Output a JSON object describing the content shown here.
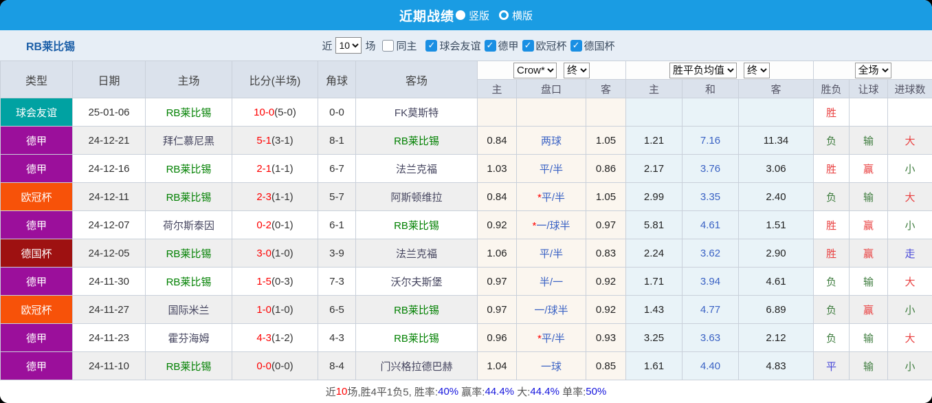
{
  "titlebar": {
    "title": "近期战绩",
    "vertical_label": "竖版",
    "horizontal_label": "横版"
  },
  "filter": {
    "team": "RB莱比锡",
    "prefix_label": "近",
    "count_value": "10",
    "suffix_label": "场",
    "same_home_label": "同主",
    "leagues": [
      "球会友谊",
      "德甲",
      "欧冠杯",
      "德国杯"
    ]
  },
  "icons": {
    "check": "✓"
  },
  "table": {
    "headers": [
      "类型",
      "日期",
      "主场",
      "比分(半场)",
      "角球",
      "客场"
    ],
    "selects": {
      "source": "Crow*",
      "source_period": "终",
      "wdl": "胜平负均值",
      "wdl_period": "终",
      "scope": "全场"
    },
    "subheaders": [
      "主",
      "盘口",
      "客",
      "主",
      "和",
      "客",
      "胜负",
      "让球",
      "进球数"
    ],
    "rows": [
      {
        "type": "球会友谊",
        "type_key": "friendly",
        "date": "25-01-06",
        "home": "RB莱比锡",
        "score": "10-0",
        "half": "(5-0)",
        "corner": "0-0",
        "away": "FK莫斯特",
        "o1": "",
        "handicap": "",
        "star": false,
        "o2": "",
        "w1": "",
        "w2": "",
        "w3": "",
        "res": "胜",
        "give": "",
        "goal": ""
      },
      {
        "type": "德甲",
        "type_key": "bundesliga",
        "date": "24-12-21",
        "home": "拜仁慕尼黑",
        "score": "5-1",
        "half": "(3-1)",
        "corner": "8-1",
        "away": "RB莱比锡",
        "o1": "0.84",
        "handicap": "两球",
        "star": false,
        "o2": "1.05",
        "w1": "1.21",
        "w2": "7.16",
        "w3": "11.34",
        "res": "负",
        "give": "输",
        "goal": "大"
      },
      {
        "type": "德甲",
        "type_key": "bundesliga",
        "date": "24-12-16",
        "home": "RB莱比锡",
        "score": "2-1",
        "half": "(1-1)",
        "corner": "6-7",
        "away": "法兰克福",
        "o1": "1.03",
        "handicap": "平/半",
        "star": false,
        "o2": "0.86",
        "w1": "2.17",
        "w2": "3.76",
        "w3": "3.06",
        "res": "胜",
        "give": "赢",
        "goal": "小"
      },
      {
        "type": "欧冠杯",
        "type_key": "ucl",
        "date": "24-12-11",
        "home": "RB莱比锡",
        "score": "2-3",
        "half": "(1-1)",
        "corner": "5-7",
        "away": "阿斯顿维拉",
        "o1": "0.84",
        "handicap": "平/半",
        "star": true,
        "o2": "1.05",
        "w1": "2.99",
        "w2": "3.35",
        "w3": "2.40",
        "res": "负",
        "give": "输",
        "goal": "大"
      },
      {
        "type": "德甲",
        "type_key": "bundesliga",
        "date": "24-12-07",
        "home": "荷尔斯泰因",
        "score": "0-2",
        "half": "(0-1)",
        "corner": "6-1",
        "away": "RB莱比锡",
        "o1": "0.92",
        "handicap": "一/球半",
        "star": true,
        "o2": "0.97",
        "w1": "5.81",
        "w2": "4.61",
        "w3": "1.51",
        "res": "胜",
        "give": "赢",
        "goal": "小"
      },
      {
        "type": "德国杯",
        "type_key": "dfb",
        "date": "24-12-05",
        "home": "RB莱比锡",
        "score": "3-0",
        "half": "(1-0)",
        "corner": "3-9",
        "away": "法兰克福",
        "o1": "1.06",
        "handicap": "平/半",
        "star": false,
        "o2": "0.83",
        "w1": "2.24",
        "w2": "3.62",
        "w3": "2.90",
        "res": "胜",
        "give": "赢",
        "goal": "走"
      },
      {
        "type": "德甲",
        "type_key": "bundesliga",
        "date": "24-11-30",
        "home": "RB莱比锡",
        "score": "1-5",
        "half": "(0-3)",
        "corner": "7-3",
        "away": "沃尔夫斯堡",
        "o1": "0.97",
        "handicap": "半/一",
        "star": false,
        "o2": "0.92",
        "w1": "1.71",
        "w2": "3.94",
        "w3": "4.61",
        "res": "负",
        "give": "输",
        "goal": "大"
      },
      {
        "type": "欧冠杯",
        "type_key": "ucl",
        "date": "24-11-27",
        "home": "国际米兰",
        "score": "1-0",
        "half": "(1-0)",
        "corner": "6-5",
        "away": "RB莱比锡",
        "o1": "0.97",
        "handicap": "一/球半",
        "star": false,
        "o2": "0.92",
        "w1": "1.43",
        "w2": "4.77",
        "w3": "6.89",
        "res": "负",
        "give": "赢",
        "goal": "小"
      },
      {
        "type": "德甲",
        "type_key": "bundesliga",
        "date": "24-11-23",
        "home": "霍芬海姆",
        "score": "4-3",
        "half": "(1-2)",
        "corner": "4-3",
        "away": "RB莱比锡",
        "o1": "0.96",
        "handicap": "平/半",
        "star": true,
        "o2": "0.93",
        "w1": "3.25",
        "w2": "3.63",
        "w3": "2.12",
        "res": "负",
        "give": "输",
        "goal": "大"
      },
      {
        "type": "德甲",
        "type_key": "bundesliga",
        "date": "24-11-10",
        "home": "RB莱比锡",
        "score": "0-0",
        "half": "(0-0)",
        "corner": "8-4",
        "away": "门兴格拉德巴赫",
        "o1": "1.04",
        "handicap": "一球",
        "star": false,
        "o2": "0.85",
        "w1": "1.61",
        "w2": "4.40",
        "w3": "4.83",
        "res": "平",
        "give": "输",
        "goal": "小"
      }
    ]
  },
  "footer": {
    "segments": [
      {
        "text": "近",
        "color": "dark"
      },
      {
        "text": "10",
        "color": "red"
      },
      {
        "text": "场,胜4平1负5, 胜率:",
        "color": "dark"
      },
      {
        "text": "40%",
        "color": "blue"
      },
      {
        "text": " 赢率:",
        "color": "dark"
      },
      {
        "text": "44.4%",
        "color": "blue"
      },
      {
        "text": " 大:",
        "color": "dark"
      },
      {
        "text": "44.4%",
        "color": "blue"
      },
      {
        "text": " 单率:",
        "color": "dark"
      },
      {
        "text": "50%",
        "color": "blue"
      }
    ]
  },
  "colors": {
    "accent": "#1a9ce3",
    "type_colors": {
      "friendly": "#00a2a2",
      "bundesliga": "#9b0f9b",
      "ucl": "#f75209",
      "dfb": "#9e1111"
    },
    "win_red": "#e94040",
    "lose_green": "#3e7c3e",
    "draw_blue": "#4848d8",
    "team_green": "#008000",
    "team_dark": "#45455f",
    "handicap_blue": "#3a62c4",
    "footer_blue": "#1414dd",
    "footer_red": "#fe0000",
    "footer_dark": "#555555"
  }
}
